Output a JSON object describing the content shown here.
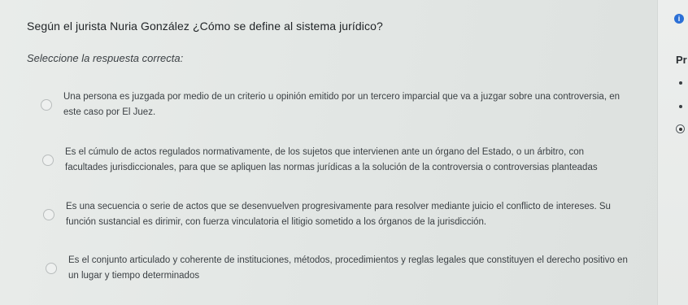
{
  "question": {
    "text": "Según el jurista Nuria González ¿Cómo se define al sistema jurídico?",
    "instruction": "Seleccione la respuesta correcta:"
  },
  "options": [
    {
      "label": "Una persona es juzgada por medio de un criterio u opinión emitido por un tercero imparcial que va a juzgar sobre una controversia, en este caso por El Juez."
    },
    {
      "label": "Es el cúmulo de actos regulados normativamente, de los sujetos que intervienen ante un órgano del Estado, o un árbitro, con facultades jurisdiccionales, para que se apliquen las normas jurídicas a la solución de la controversia o controversias planteadas"
    },
    {
      "label": "Es una secuencia o serie de actos que se desenvuelven progresivamente para resolver mediante juicio el conflicto de intereses. Su función sustancial es dirimir, con fuerza vinculatoria el litigio sometido a los órganos de la jurisdicción."
    },
    {
      "label": "Es el conjunto articulado y coherente de instituciones, métodos, procedimientos y reglas legales que constituyen el derecho positivo en un lugar y tiempo determinados"
    }
  ],
  "side_panel": {
    "label": "Pr",
    "info_icon": "info-icon",
    "info_color": "#2b6fd6"
  }
}
